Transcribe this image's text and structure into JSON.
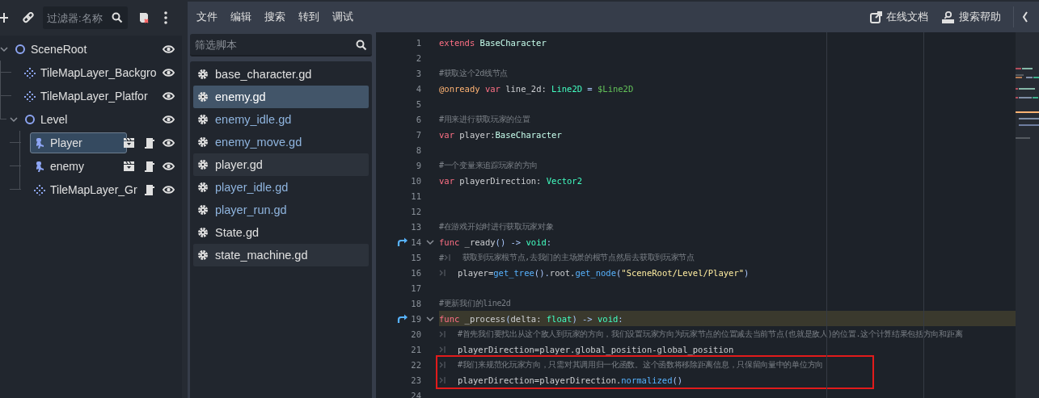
{
  "scene_dock": {
    "filter_placeholder": "过滤器:名称",
    "nodes": [
      {
        "name": "SceneRoot",
        "kind": "node2d",
        "expanded": true,
        "selected": false,
        "scene": false,
        "script": false,
        "visible": true,
        "children": [
          {
            "name": "TileMapLayer_Backgro",
            "kind": "tilemap",
            "selected": false,
            "scene": false,
            "script": false,
            "visible": true
          },
          {
            "name": "TileMapLayer_Platfor",
            "kind": "tilemap",
            "selected": false,
            "scene": false,
            "script": false,
            "visible": true
          },
          {
            "name": "Level",
            "kind": "node2d",
            "expanded": true,
            "selected": false,
            "scene": false,
            "script": false,
            "visible": true,
            "children": [
              {
                "name": "Player",
                "kind": "character",
                "selected": true,
                "scene": true,
                "script": true,
                "visible": true
              },
              {
                "name": "enemy",
                "kind": "character",
                "selected": false,
                "scene": true,
                "script": true,
                "visible": true
              },
              {
                "name": "TileMapLayer_Gr",
                "kind": "tilemap",
                "selected": false,
                "scene": false,
                "script": true,
                "visible": true
              }
            ]
          }
        ]
      }
    ]
  },
  "menu": [
    "文件",
    "编辑",
    "搜索",
    "转到",
    "调试"
  ],
  "help_links": [
    {
      "kind": "docs",
      "label": "在线文档"
    },
    {
      "kind": "search_help",
      "label": "搜索帮助"
    }
  ],
  "script_list": {
    "filter_placeholder": "筛选脚本",
    "items": [
      {
        "name": "base_character.gd",
        "color": "#e0e0e0",
        "selected": false,
        "highlighted": false
      },
      {
        "name": "enemy.gd",
        "color": "#ffffff",
        "selected": true,
        "highlighted": false
      },
      {
        "name": "enemy_idle.gd",
        "color": "#8fb4de",
        "selected": false,
        "highlighted": false
      },
      {
        "name": "enemy_move.gd",
        "color": "#8fb4de",
        "selected": false,
        "highlighted": false
      },
      {
        "name": "player.gd",
        "color": "#e0e0e0",
        "selected": false,
        "highlighted": true
      },
      {
        "name": "player_idle.gd",
        "color": "#8fb4de",
        "selected": false,
        "highlighted": false
      },
      {
        "name": "player_run.gd",
        "color": "#8fb4de",
        "selected": false,
        "highlighted": false
      },
      {
        "name": "State.gd",
        "color": "#e0e0e0",
        "selected": false,
        "highlighted": false
      },
      {
        "name": "state_machine.gd",
        "color": "#e0e0e0",
        "selected": false,
        "highlighted": true
      }
    ]
  },
  "editor": {
    "lines": [
      {
        "number": "1",
        "override": false,
        "foldable": false,
        "current": false,
        "boxed": false,
        "tokens": [
          {
            "kind": "keyword",
            "text": "extends"
          },
          {
            "kind": "class",
            "text": " BaseCharacter"
          }
        ]
      },
      {
        "number": "2",
        "override": false,
        "foldable": false,
        "current": false,
        "boxed": false
      },
      {
        "number": "3",
        "override": false,
        "foldable": false,
        "current": false,
        "boxed": false,
        "tokens": [
          {
            "kind": "comment",
            "text": "#获取这个2d线节点"
          }
        ]
      },
      {
        "number": "4",
        "override": false,
        "foldable": false,
        "current": false,
        "boxed": false,
        "tokens": [
          {
            "kind": "annotation",
            "text": "@onready"
          },
          {
            "kind": "keyword",
            "text": " var"
          },
          {
            "kind": "identifier",
            "text": " line_2d: "
          },
          {
            "kind": "type",
            "text": "Line2D"
          },
          {
            "kind": "symbol",
            "text": " = "
          },
          {
            "kind": "nodepath",
            "text": "$Line2D"
          }
        ]
      },
      {
        "number": "5",
        "override": false,
        "foldable": false,
        "current": false,
        "boxed": false
      },
      {
        "number": "6",
        "override": false,
        "foldable": false,
        "current": false,
        "boxed": false,
        "tokens": [
          {
            "kind": "comment",
            "text": "#用来进行获取玩家的位置"
          }
        ]
      },
      {
        "number": "7",
        "override": false,
        "foldable": false,
        "current": false,
        "boxed": false,
        "tokens": [
          {
            "kind": "keyword",
            "text": "var"
          },
          {
            "kind": "identifier",
            "text": " player:"
          },
          {
            "kind": "class",
            "text": "BaseCharacter"
          }
        ]
      },
      {
        "number": "8",
        "override": false,
        "foldable": false,
        "current": false,
        "boxed": false
      },
      {
        "number": "9",
        "override": false,
        "foldable": false,
        "current": false,
        "boxed": false,
        "tokens": [
          {
            "kind": "comment",
            "text": "#一个变量来追踪玩家的方向"
          }
        ]
      },
      {
        "number": "10",
        "override": false,
        "foldable": false,
        "current": false,
        "boxed": false,
        "tokens": [
          {
            "kind": "keyword",
            "text": "var"
          },
          {
            "kind": "identifier",
            "text": " playerDirection: "
          },
          {
            "kind": "type",
            "text": "Vector2"
          }
        ]
      },
      {
        "number": "11",
        "override": false,
        "foldable": false,
        "current": false,
        "boxed": false
      },
      {
        "number": "12",
        "override": false,
        "foldable": false,
        "current": false,
        "boxed": false
      },
      {
        "number": "13",
        "override": false,
        "foldable": false,
        "current": false,
        "boxed": false,
        "tokens": [
          {
            "kind": "comment",
            "text": "#在游戏开始时进行获取玩家对象"
          }
        ]
      },
      {
        "number": "14",
        "override": true,
        "foldable": true,
        "current": false,
        "boxed": false,
        "tokens": [
          {
            "kind": "keyword",
            "text": "func"
          },
          {
            "kind": "identifier",
            "text": " _ready"
          },
          {
            "kind": "symbol",
            "text": "() -> "
          },
          {
            "kind": "type",
            "text": "void"
          },
          {
            "kind": "symbol",
            "text": ":"
          }
        ]
      },
      {
        "number": "15",
        "override": false,
        "foldable": false,
        "current": false,
        "boxed": false,
        "tokens": [
          {
            "kind": "comment",
            "text": "#"
          },
          {
            "kind": "tab"
          },
          {
            "kind": "comment",
            "text": "获取到玩家根节点,去我们的主场景的根节点然后去获取到玩家节点"
          }
        ]
      },
      {
        "number": "16",
        "override": false,
        "foldable": false,
        "current": false,
        "boxed": false,
        "tokens": [
          {
            "kind": "tab"
          },
          {
            "kind": "identifier",
            "text": "player="
          },
          {
            "kind": "call",
            "text": "get_tree"
          },
          {
            "kind": "symbol",
            "text": "()."
          },
          {
            "kind": "identifier",
            "text": "root."
          },
          {
            "kind": "call",
            "text": "get_node"
          },
          {
            "kind": "symbol",
            "text": "("
          },
          {
            "kind": "string",
            "text": "\"SceneRoot/Level/Player\""
          },
          {
            "kind": "symbol",
            "text": ")"
          }
        ]
      },
      {
        "number": "17",
        "override": false,
        "foldable": false,
        "current": false,
        "boxed": false
      },
      {
        "number": "18",
        "override": false,
        "foldable": false,
        "current": false,
        "boxed": false,
        "tokens": [
          {
            "kind": "comment",
            "text": "#更新我们的line2d"
          }
        ]
      },
      {
        "number": "19",
        "override": true,
        "foldable": true,
        "current": true,
        "boxed": false,
        "tokens": [
          {
            "kind": "keyword",
            "text": "func"
          },
          {
            "kind": "identifier",
            "text": " _process"
          },
          {
            "kind": "symbol",
            "text": "("
          },
          {
            "kind": "identifier",
            "text": "delta: "
          },
          {
            "kind": "type",
            "text": "float"
          },
          {
            "kind": "symbol",
            "text": ") -> "
          },
          {
            "kind": "type",
            "text": "void"
          },
          {
            "kind": "symbol",
            "text": ":"
          }
        ]
      },
      {
        "number": "20",
        "override": false,
        "foldable": false,
        "current": false,
        "boxed": false,
        "tokens": [
          {
            "kind": "tab"
          },
          {
            "kind": "comment",
            "text": "#首先我们要找出从这个敌人到玩家的方向，我们设置玩家方向为玩家节点的位置减去当前节点(也就是敌人)的位置.这个计算结果包括方向和距离"
          }
        ]
      },
      {
        "number": "21",
        "override": false,
        "foldable": false,
        "current": false,
        "boxed": false,
        "tokens": [
          {
            "kind": "tab"
          },
          {
            "kind": "identifier",
            "text": "playerDirection=player.global_position-global_position"
          }
        ]
      },
      {
        "number": "22",
        "override": false,
        "foldable": false,
        "current": false,
        "boxed": true,
        "tokens": [
          {
            "kind": "tab"
          },
          {
            "kind": "comment",
            "text": "#我们来规范化玩家方向，只需对其调用归一化函数。这个函数将移除距离信息，只保留向量中的单位方向"
          }
        ]
      },
      {
        "number": "23",
        "override": false,
        "foldable": false,
        "current": false,
        "boxed": true,
        "tokens": [
          {
            "kind": "tab"
          },
          {
            "kind": "identifier",
            "text": "playerDirection=playerDirection."
          },
          {
            "kind": "call",
            "text": "normalized"
          },
          {
            "kind": "symbol",
            "text": "()"
          }
        ]
      },
      {
        "number": "24",
        "override": false,
        "foldable": false,
        "current": false,
        "boxed": false
      }
    ]
  }
}
